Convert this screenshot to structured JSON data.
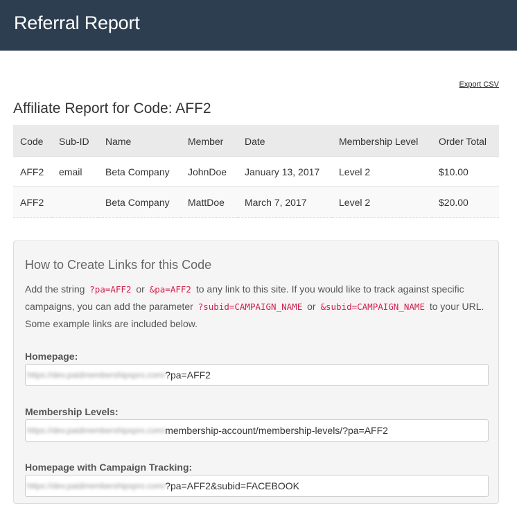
{
  "header": {
    "title": "Referral Report"
  },
  "export": {
    "label": "Export CSV"
  },
  "report": {
    "title": "Affiliate Report for Code: AFF2",
    "columns": [
      "Code",
      "Sub-ID",
      "Name",
      "Member",
      "Date",
      "Membership Level",
      "Order Total"
    ],
    "rows": [
      [
        "AFF2",
        "email",
        "Beta Company",
        "JohnDoe",
        "January 13, 2017",
        "Level 2",
        "$10.00"
      ],
      [
        "AFF2",
        "",
        "Beta Company",
        "MattDoe",
        "March 7, 2017",
        "Level 2",
        "$20.00"
      ]
    ]
  },
  "links_panel": {
    "title": "How to Create Links for this Code",
    "desc_1": "Add the string ",
    "code_1": "?pa=AFF2",
    "desc_2": " or ",
    "code_2": "&pa=AFF2",
    "desc_3": " to any link to this site. If you would like to track against specific campaigns, you can add the parameter ",
    "code_3": "?subid=CAMPAIGN_NAME",
    "desc_4": " or ",
    "code_4": "&subid=CAMPAIGN_NAME",
    "desc_5": " to your URL. Some example links are included below.",
    "fields": [
      {
        "label": "Homepage:",
        "base": "https://dev.paidmembershipspro.com/",
        "suffix": "?pa=AFF2"
      },
      {
        "label": "Membership Levels:",
        "base": "https://dev.paidmembershipspro.com/",
        "suffix": "membership-account/membership-levels/?pa=AFF2"
      },
      {
        "label": "Homepage with Campaign Tracking:",
        "base": "https://dev.paidmembershipspro.com/",
        "suffix": "?pa=AFF2&subid=FACEBOOK"
      }
    ]
  }
}
